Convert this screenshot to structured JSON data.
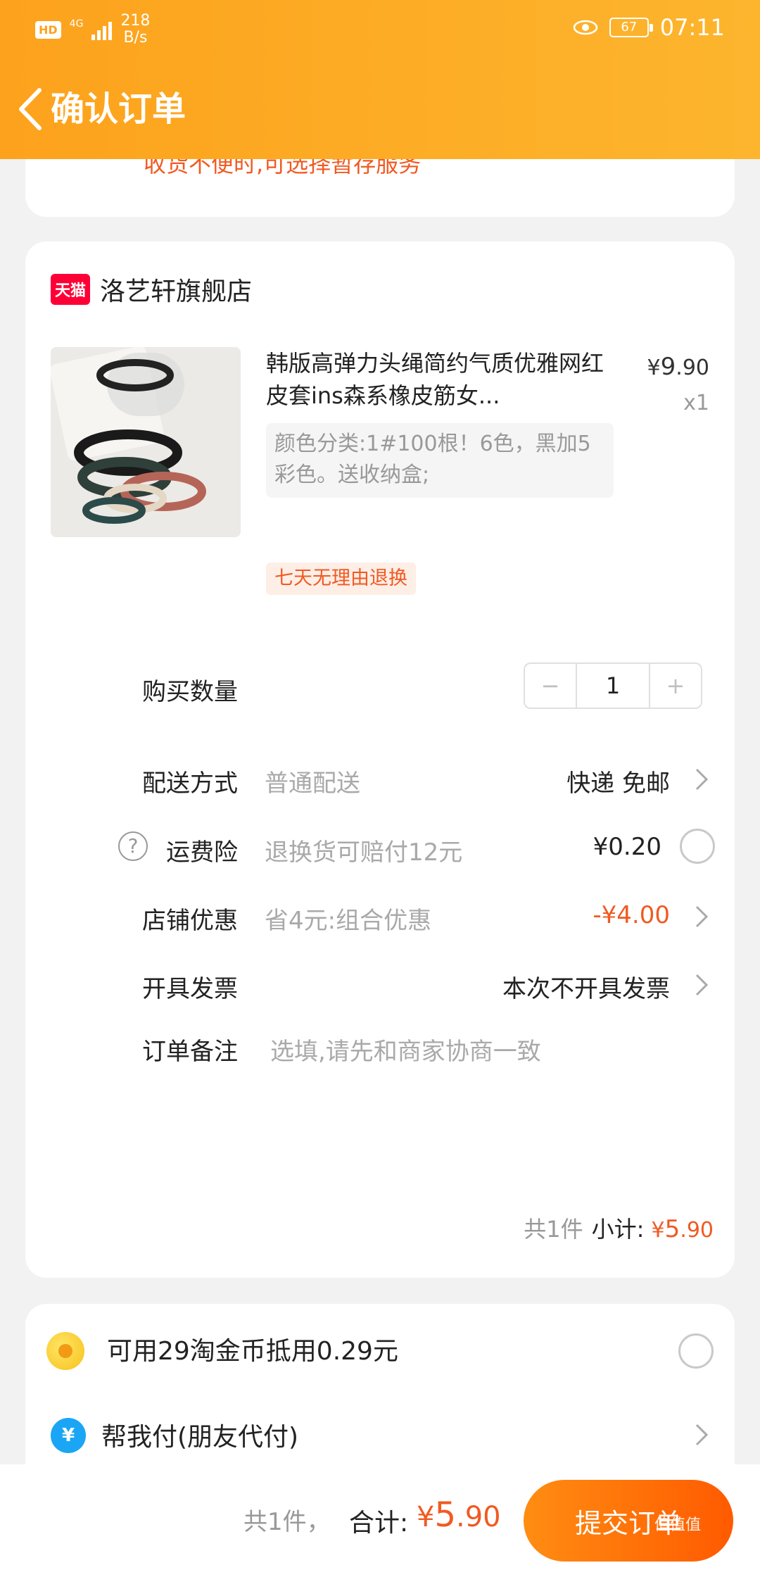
{
  "status_bar": {
    "hd": "HD",
    "network": "4G",
    "speed_value": "218",
    "speed_unit": "B/s",
    "battery": "67",
    "time": "07:11"
  },
  "header": {
    "title": "确认订单"
  },
  "notice": "收货不便时,可选择暂存服务",
  "shop": {
    "badge": "天猫",
    "name": "洛艺轩旗舰店"
  },
  "product": {
    "title": "韩版高弹力头绳简约气质优雅网红皮套ins森系橡皮筋女...",
    "price_symbol": "¥",
    "price_int": "9",
    "price_dec": ".90",
    "quantity": "x1",
    "sku": "颜色分类:1#100根！6色，黑加5彩色。送收纳盒;",
    "tag": "七天无理由退换"
  },
  "rows": {
    "quantity": {
      "label": "购买数量",
      "minus": "−",
      "value": "1",
      "plus": "+"
    },
    "delivery": {
      "label": "配送方式",
      "desc": "普通配送",
      "value": "快递 免邮"
    },
    "insurance": {
      "label": "运费险",
      "desc": "退换货可赔付12元",
      "value": "¥0.20",
      "help": "?"
    },
    "discount": {
      "label": "店铺优惠",
      "desc": "省4元:组合优惠",
      "value": "-¥4.00"
    },
    "invoice": {
      "label": "开具发票",
      "value": "本次不开具发票"
    },
    "remark": {
      "label": "订单备注",
      "placeholder": "选填,请先和商家协商一致"
    }
  },
  "subtotal": {
    "count": "共1件",
    "label": "小计:",
    "symbol": "¥",
    "int": "5",
    "dec": ".90"
  },
  "extras": {
    "coins": "可用29淘金币抵用0.29元",
    "friend_pay": "帮我付(朋友代付)",
    "friend_pay_icon": "¥"
  },
  "bottom": {
    "count": "共1件，",
    "label": "合计:",
    "symbol": "¥",
    "int": "5",
    "dec": ".90",
    "submit": "提交订单"
  },
  "watermark": "值值值",
  "colors": {
    "header": "#fda21c",
    "accent": "#f05a22",
    "tmall": "#ff0036"
  }
}
